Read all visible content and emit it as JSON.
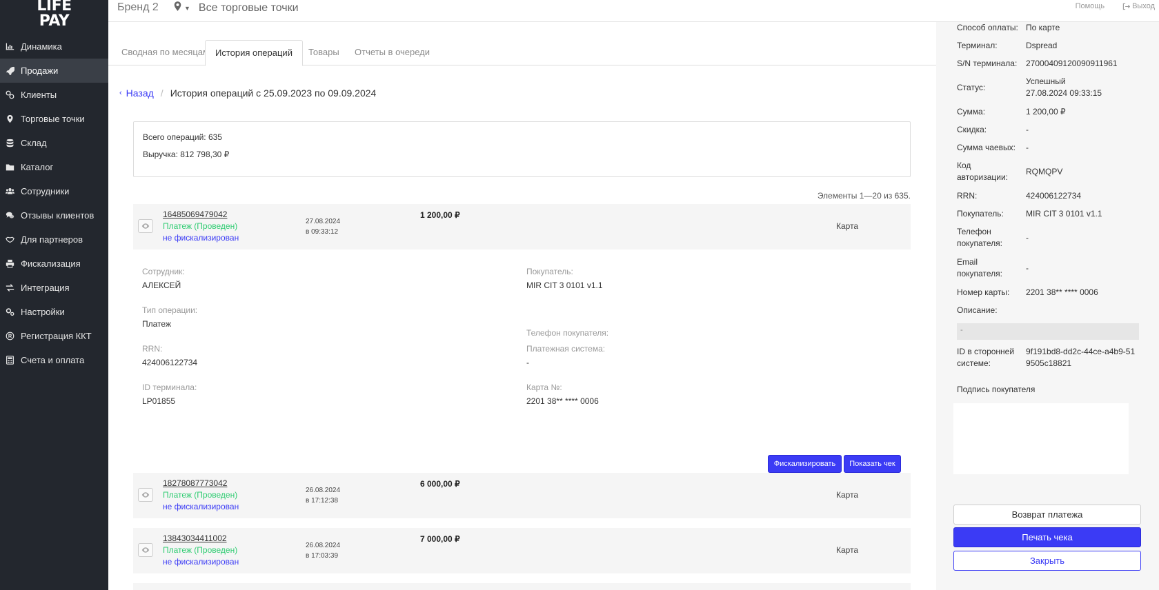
{
  "logo": {
    "line1": "LIFE",
    "line2": "PAY"
  },
  "sidebar": {
    "items": [
      {
        "label": "Динамика",
        "icon": "bar-chart-icon"
      },
      {
        "label": "Продажи",
        "icon": "rocket-icon",
        "active": true
      },
      {
        "label": "Клиенты",
        "icon": "link-icon"
      },
      {
        "label": "Торговые точки",
        "icon": "map-marker-icon"
      },
      {
        "label": "Склад",
        "icon": "database-icon"
      },
      {
        "label": "Каталог",
        "icon": "folder-icon"
      },
      {
        "label": "Сотрудники",
        "icon": "users-icon"
      },
      {
        "label": "Отзывы клиентов",
        "icon": "comments-icon"
      },
      {
        "label": "Для партнеров",
        "icon": "handshake-icon"
      },
      {
        "label": "Фискализация",
        "icon": "print-icon"
      },
      {
        "label": "Интеграция",
        "icon": "exchange-icon"
      },
      {
        "label": "Настройки",
        "icon": "cogs-icon"
      },
      {
        "label": "Регистрация ККТ",
        "icon": "registered-icon"
      },
      {
        "label": "Счета и оплата",
        "icon": "calculator-icon"
      }
    ]
  },
  "header": {
    "brand": "Бренд 2",
    "location": "Все торговые точки",
    "help": "Помощь",
    "logout": "Выход"
  },
  "tabs": [
    {
      "label": "Сводная по месяцам"
    },
    {
      "label": "История операций",
      "active": true
    },
    {
      "label": "Товары"
    },
    {
      "label": "Отчеты в очереди"
    }
  ],
  "breadcrumb": {
    "back": "Назад",
    "title": "История операций с 25.09.2023 по 09.09.2024"
  },
  "summary": {
    "total_ops": "Всего операций: 635",
    "revenue": "Выручка: 812 798,30  ₽"
  },
  "pager": "Элементы 1—20 из 635.",
  "operations": [
    {
      "id": "16485069479042",
      "status": "Платеж (Проведен)",
      "fiscal": "не фискализирован",
      "date": "27.08.2024",
      "time": "в 09:33:12",
      "amount": "1 200,00  ₽",
      "type": "Карта"
    },
    {
      "id": "18278087773042",
      "status": "Платеж (Проведен)",
      "fiscal": "не фискализирован",
      "date": "26.08.2024",
      "time": "в 17:12:38",
      "amount": "6 000,00  ₽",
      "type": "Карта"
    },
    {
      "id": "13843034411002",
      "status": "Платеж (Проведен)",
      "fiscal": "не фискализирован",
      "date": "26.08.2024",
      "time": "в 17:03:39",
      "amount": "7 000,00  ₽",
      "type": "Карта"
    }
  ],
  "details": {
    "employee_label": "Сотрудник:",
    "employee": "АЛЕКСЕЙ",
    "optype_label": "Тип операции:",
    "optype": "Платеж",
    "rrn_label": "RRN:",
    "rrn": "424006122734",
    "terminal_label": "ID терминала:",
    "terminal": "LP01855",
    "buyer_label": "Покупатель:",
    "buyer": "MIR CIT 3 0101 v1.1",
    "phone_label": "Телефон покупателя:",
    "paysys_label": "Платежная система:",
    "paysys": "-",
    "card_label": "Карта №:",
    "card": "2201 38** **** 0006",
    "fiscalize_btn": "Фискализировать",
    "show_receipt_btn": "Показать чек"
  },
  "panel": {
    "pay_method_label": "Способ оплаты:",
    "pay_method": "По карте",
    "terminal_label": "Терминал:",
    "terminal": "Dspread",
    "sn_label": "S/N терминала:",
    "sn": "27000409120090911961",
    "status_label": "Статус:",
    "status": "Успешный",
    "status_time": "27.08.2024 09:33:15",
    "sum_label": "Сумма:",
    "sum": "1 200,00 ₽",
    "discount_label": "Скидка:",
    "discount": "-",
    "tips_label": "Сумма чаевых:",
    "tips": "-",
    "auth_label": "Код авторизации:",
    "auth": "RQMQPV",
    "rrn_label": "RRN:",
    "rrn": "424006122734",
    "buyer_label": "Покупатель:",
    "buyer": "MIR CIT 3 0101 v1.1",
    "phone_label": "Телефон покупателя:",
    "phone": "-",
    "email_label": "Email покупателя:",
    "email": "-",
    "card_label": "Номер карты:",
    "card": "2201 38** **** 0006",
    "desc_label": "Описание:",
    "desc": "-",
    "ext_id_label": "ID в сторонней системе:",
    "ext_id": "9f191bd8-dd2c-44ce-a4b9-519505c18821",
    "signature_label": "Подпись покупателя",
    "refund_btn": "Возврат платежа",
    "print_btn": "Печать чека",
    "close_btn": "Закрыть"
  },
  "colors": {
    "sidebar_bg": "#23272e",
    "accent": "#3b3bf5",
    "success": "#2ecc71"
  }
}
